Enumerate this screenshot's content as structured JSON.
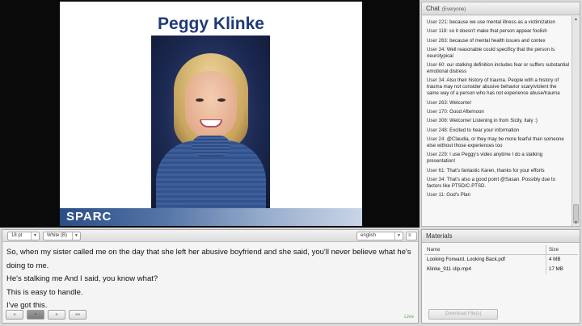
{
  "slide": {
    "title": "Peggy Klinke",
    "logo_text": "SPARC"
  },
  "chat": {
    "title": "Chat",
    "scope": "(Everyone)",
    "messages": [
      {
        "user": "User 221:",
        "text": "because we use mental illness as a victimization"
      },
      {
        "user": "User 118:",
        "text": "so it doesn't make that person appear foolish"
      },
      {
        "user": "User 263:",
        "text": "because of mental health issues and contex"
      },
      {
        "user": "User 34:",
        "text": "Well reasonable could specificy that the person is neurotypical"
      },
      {
        "user": "User 60:",
        "text": "our stalking definition includes fear or suffers substantial emotional distress"
      },
      {
        "user": "User 34:",
        "text": "Also their history of trauma. People with a history of trauma may not consider abusive behavior scary/violent the same way of a person who has not experience abuse/trauma"
      },
      {
        "user": "User 263:",
        "text": "Welcome!"
      },
      {
        "user": "User 170:",
        "text": "Good Afternoon"
      },
      {
        "user": "User 308:",
        "text": "Welcome! Listening in from Sicily, Italy :)"
      },
      {
        "user": "User 248:",
        "text": "Excited to hear your information"
      },
      {
        "user": "User 24:",
        "text": "@Claudia, or they may be more fearful than someone else without those experiences too"
      },
      {
        "user": "User 229:",
        "text": "I use Peggy's video anytime I do a stalking presentation!"
      },
      {
        "user": "User 61:",
        "text": "That's fantastic Karen, thanks for your efforts"
      },
      {
        "user": "User 34:",
        "text": "That's also a good point @Sasan. Possibly due to factors like PTSD/C-PTSD."
      },
      {
        "user": "User 11:",
        "text": "God's Plan"
      }
    ]
  },
  "captions": {
    "font_size": "18 pt",
    "color": "White (B)",
    "language": "english",
    "lines": [
      "So, when my sister called me on the day that she left her abusive boyfriend and she said, you'll never believe what he's",
      "doing to me.",
      "He's stalking me And I said, you know what?",
      "This is easy to handle.",
      "I've got this."
    ],
    "controls": [
      "«",
      "•",
      "»",
      "»»"
    ],
    "live_label": "Live"
  },
  "materials": {
    "title": "Materials",
    "columns": [
      "Name",
      "Size"
    ],
    "rows": [
      {
        "name": "Looking Forward, Looking Back.pdf",
        "size": "4 MB"
      },
      {
        "name": "Klinke_911 clip.mp4",
        "size": "17 MB"
      }
    ],
    "download_label": "Download File(s)"
  }
}
